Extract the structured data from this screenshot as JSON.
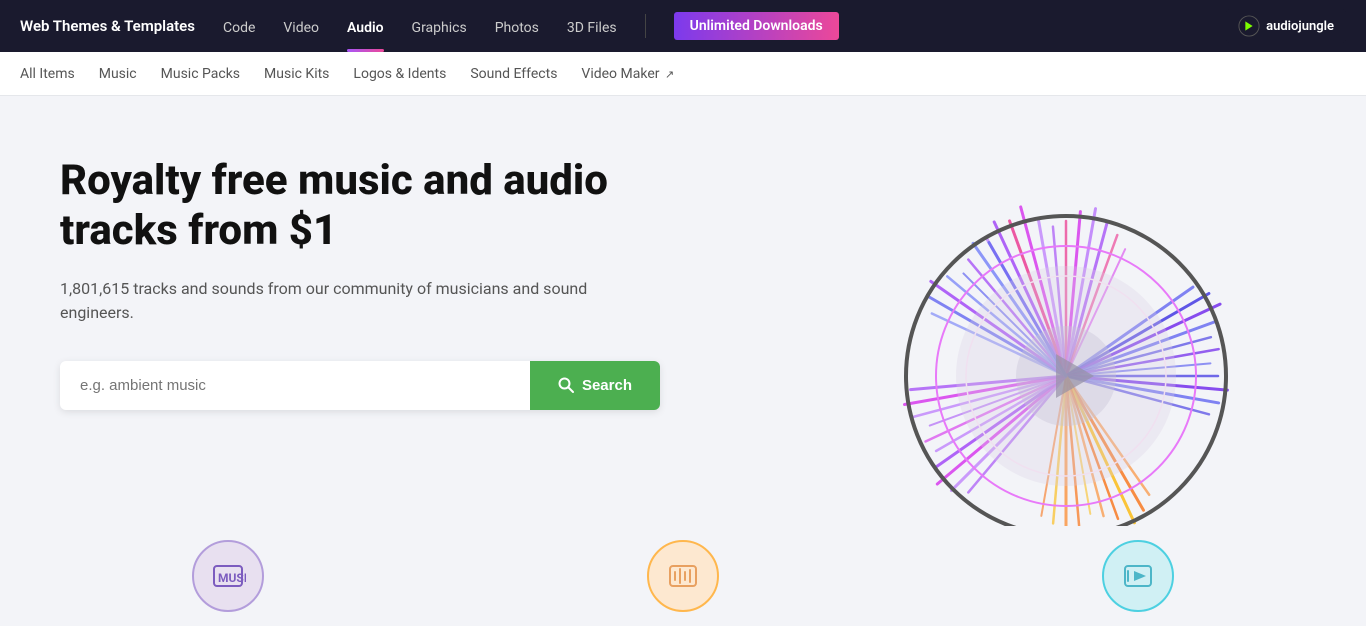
{
  "brand": {
    "title": "Web Themes & Templates",
    "logo_text": "audiojungle"
  },
  "top_nav": {
    "items": [
      {
        "label": "Code",
        "active": false
      },
      {
        "label": "Video",
        "active": false
      },
      {
        "label": "Audio",
        "active": true
      },
      {
        "label": "Graphics",
        "active": false
      },
      {
        "label": "Photos",
        "active": false
      },
      {
        "label": "3D Files",
        "active": false
      }
    ],
    "unlimited_label": "Unlimited Downloads"
  },
  "sub_nav": {
    "items": [
      {
        "label": "All Items",
        "active": false
      },
      {
        "label": "Music",
        "active": false
      },
      {
        "label": "Music Packs",
        "active": false
      },
      {
        "label": "Music Kits",
        "active": false
      },
      {
        "label": "Logos & Idents",
        "active": false
      },
      {
        "label": "Sound Effects",
        "active": false
      },
      {
        "label": "Video Maker",
        "active": false,
        "external": true
      }
    ]
  },
  "hero": {
    "title": "Royalty free music and audio tracks from $1",
    "subtitle": "1,801,615 tracks and sounds from our community of musicians and sound engineers.",
    "search_placeholder": "e.g. ambient music",
    "search_button": "Search"
  },
  "bottom_icons": [
    {
      "type": "music",
      "symbol": "🎵",
      "bg": "#e8e0f0",
      "border": "#b39ddb"
    },
    {
      "type": "sound",
      "symbol": "🎶",
      "bg": "#fde8d0",
      "border": "#ffb74d"
    },
    {
      "type": "kit",
      "symbol": "📢",
      "bg": "#d0f0f4",
      "border": "#4dd0e1"
    }
  ],
  "colors": {
    "nav_bg": "#1a1a2e",
    "active_tab": "#ffffff",
    "gradient_start": "#a855f7",
    "gradient_end": "#ec4899",
    "search_btn": "#4caf50",
    "hero_bg": "#f3f4f8"
  }
}
